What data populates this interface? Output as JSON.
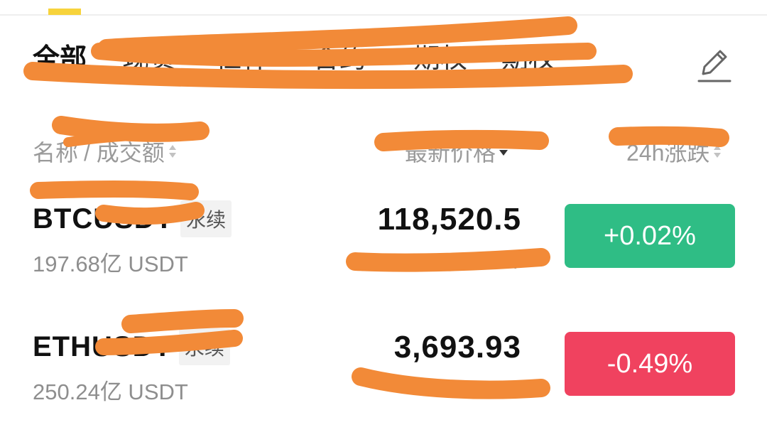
{
  "tabs": [
    {
      "label": "全部",
      "active": true
    },
    {
      "label": "现货",
      "active": false
    },
    {
      "label": "杠杆",
      "active": false
    },
    {
      "label": "合约",
      "active": false
    },
    {
      "label": "期权",
      "active": false
    },
    {
      "label": "期权",
      "active": false
    }
  ],
  "edit_icon": "pencil-icon",
  "header": {
    "name_label": "名称",
    "volume_label": "/ 成交额",
    "price_label": "最新价格",
    "change_label": "24h涨跌"
  },
  "rows": [
    {
      "symbol": "BTCUSDT",
      "badge": "永续",
      "volume": "197.68亿 USDT",
      "price": "118,520.5",
      "sub_price": "¥",
      "change": "+0.02%",
      "change_color": "#2fbd85"
    },
    {
      "symbol": "ETHUSDT",
      "badge": "永续",
      "volume": "250.24亿 USDT",
      "price": "3,693.93",
      "sub_price": "¥",
      "change": "-0.49%",
      "change_color": "#f0425f"
    }
  ],
  "colors": {
    "accent": "#f7d33c",
    "up": "#2fbd85",
    "down": "#f0425f",
    "redaction": "#f28a38"
  }
}
